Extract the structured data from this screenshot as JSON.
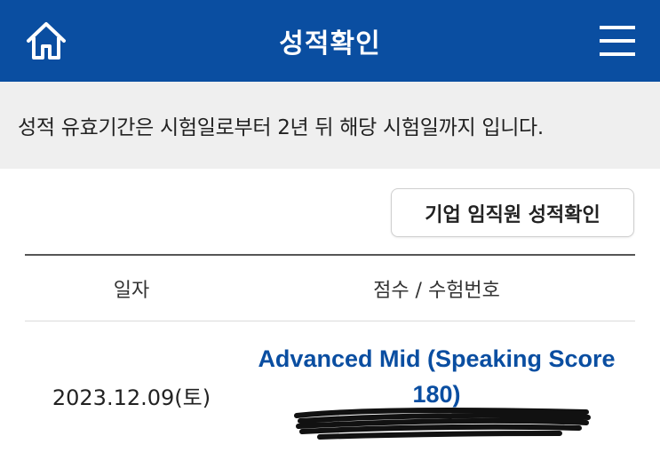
{
  "header": {
    "title": "성적확인",
    "home_icon": "home-icon",
    "menu_icon": "hamburger-menu-icon",
    "background": "#0a4ea1"
  },
  "notice": {
    "text": "성적 유효기간은 시험일로부터 2년 뒤 해당 시험일까지 입니다."
  },
  "corp_button": {
    "label": "기업 임직원 성적확인"
  },
  "table": {
    "columns": [
      "일자",
      "점수 / 수험번호"
    ],
    "rows": [
      {
        "date": "2023.12.09(토)",
        "score": "Advanced Mid (Speaking Score 180)",
        "exam_number": "[redacted]"
      }
    ]
  },
  "colors": {
    "accent": "#0a4ea1",
    "notice_bg": "#efefef"
  }
}
